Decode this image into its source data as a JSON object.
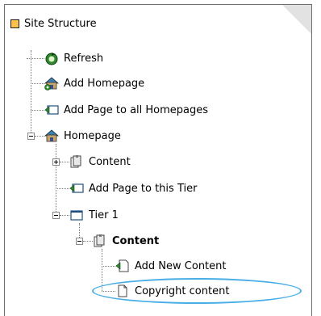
{
  "header": {
    "title": "Site Structure"
  },
  "tree": {
    "refresh": "Refresh",
    "add_homepage": "Add Homepage",
    "add_page_all_homepages": "Add Page to all Homepages",
    "homepage": "Homepage",
    "content_1": "Content",
    "add_page_this_tier": "Add Page to this Tier",
    "tier_1": "Tier 1",
    "content_2": "Content",
    "add_new_content": "Add New Content",
    "copyright_content": "Copyright content"
  },
  "colors": {
    "highlight_ellipse": "#4aaee6",
    "title_marker": "#fbc24b"
  }
}
